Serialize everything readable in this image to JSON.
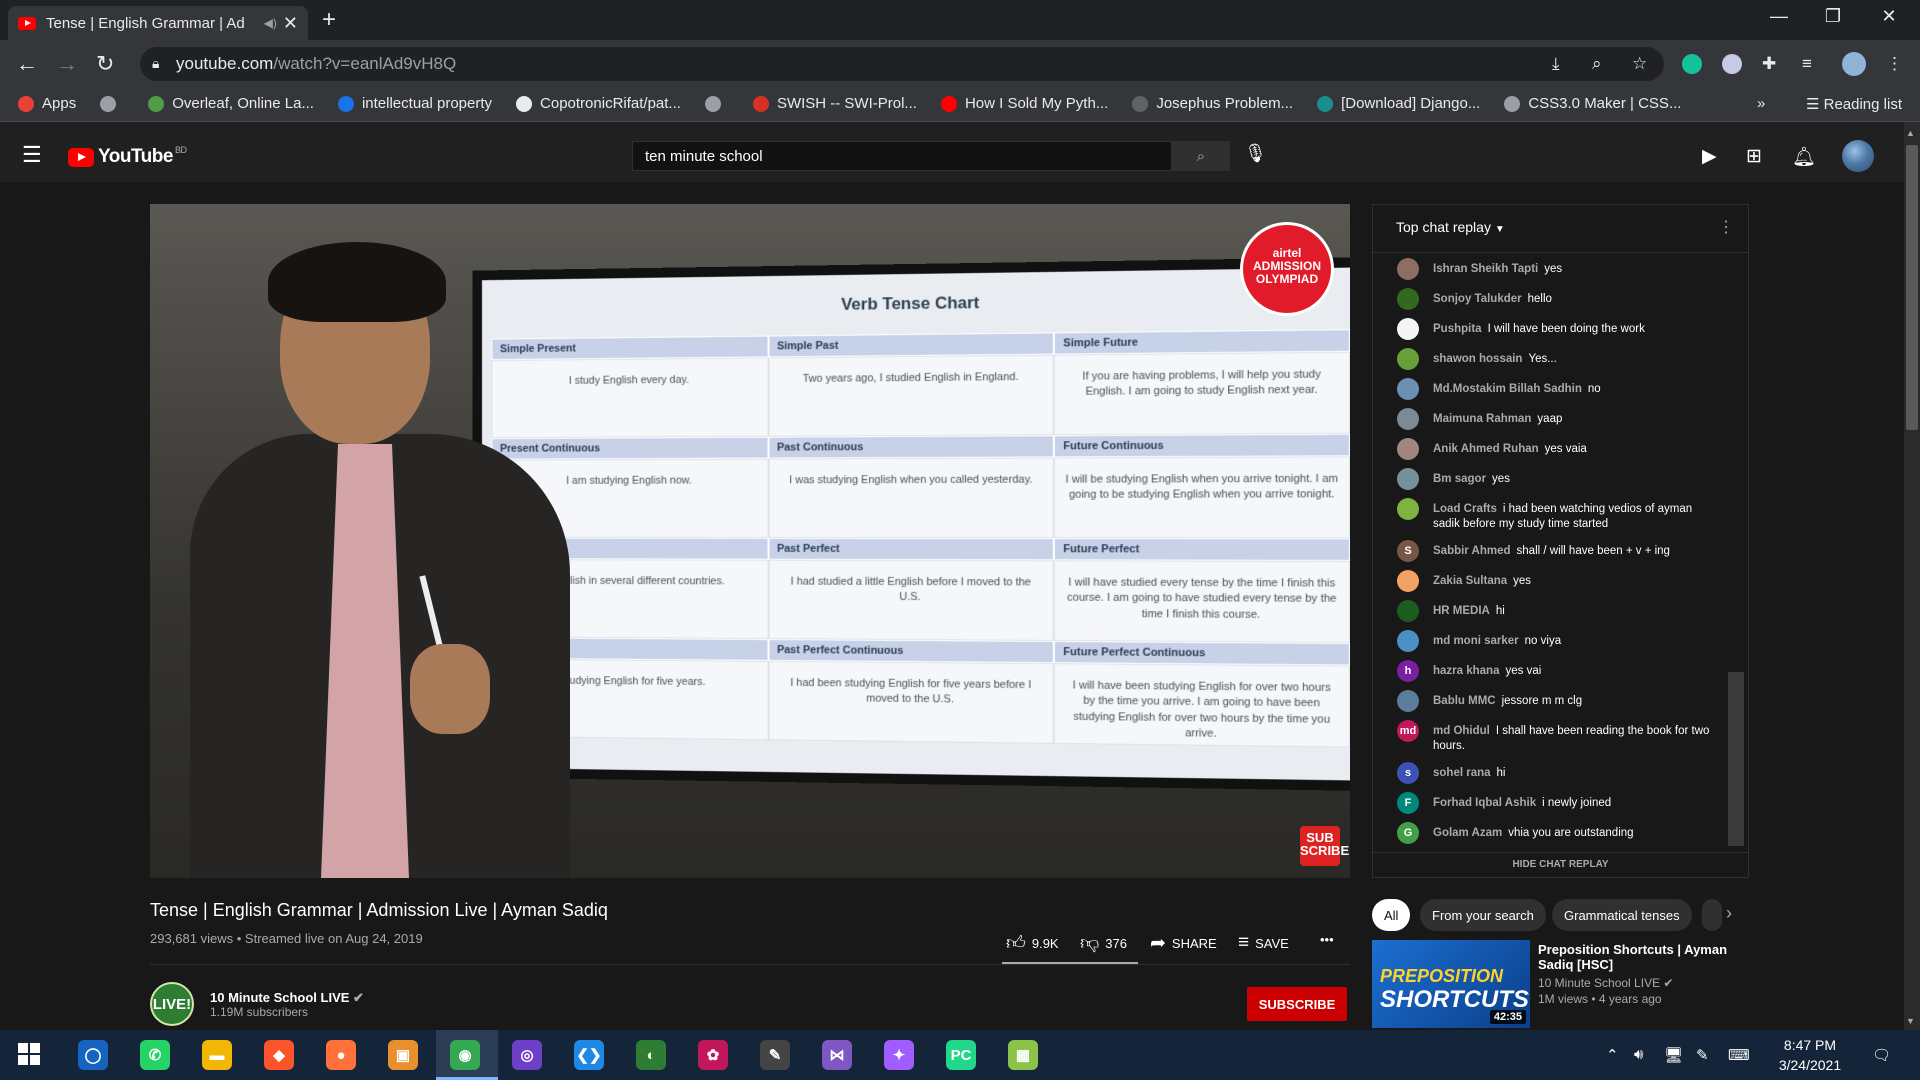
{
  "browser": {
    "tab_title": "Tense | English Grammar | Ad",
    "tab_close": "✕",
    "new_tab": "+",
    "url_host": "youtube.com",
    "url_path": "/watch?v=eanlAd9vH8Q",
    "window_controls": [
      "—",
      "❐",
      "✕"
    ],
    "bookmarks": [
      {
        "label": "Apps",
        "icon": "apps-grid-icon",
        "color": "#ea4335"
      },
      {
        "label": "",
        "icon": "globe-icon",
        "color": "#9aa0a6"
      },
      {
        "label": "Overleaf, Online La...",
        "icon": "overleaf-icon",
        "color": "#4f9c45"
      },
      {
        "label": "intellectual property",
        "icon": "s-icon",
        "color": "#1a73e8"
      },
      {
        "label": "CopotronicRifat/pat...",
        "icon": "github-icon",
        "color": "#e8eaed"
      },
      {
        "label": "",
        "icon": "globe-icon",
        "color": "#9aa0a6"
      },
      {
        "label": "SWISH -- SWI-Prol...",
        "icon": "swish-icon",
        "color": "#d93025"
      },
      {
        "label": "How I Sold My Pyth...",
        "icon": "youtube-icon",
        "color": "#ff0000"
      },
      {
        "label": "Josephus Problem...",
        "icon": "loading-icon",
        "color": "#5f6368"
      },
      {
        "label": "[Download] Django...",
        "icon": "django-icon",
        "color": "#1b8d8a"
      },
      {
        "label": "CSS3.0 Maker | CSS...",
        "icon": "globe-icon",
        "color": "#9aa0a6"
      }
    ],
    "more_bookmarks": "»",
    "reading_list": "Reading list"
  },
  "youtube": {
    "logo_text": "YouTube",
    "country_code": "BD",
    "search_value": "ten minute school"
  },
  "video": {
    "title": "Tense | English Grammar | Admission Live | Ayman Sadiq",
    "views": "293,681 views",
    "streamed": "Streamed live on Aug 24, 2019",
    "likes": "9.9K",
    "dislikes": "376",
    "share": "SHARE",
    "save": "SAVE",
    "more": "•••",
    "overlay_badge": "airtel ADMISSION OLYMPIAD",
    "overlay_sub": "SUB SCRIBE",
    "board": {
      "title": "Verb Tense Chart",
      "headers": [
        [
          "Simple Present",
          "Simple Past",
          "Simple Future"
        ],
        [
          "Present Continuous",
          "Past Continuous",
          "Future Continuous"
        ],
        [
          "",
          "Past Perfect",
          "Future Perfect"
        ],
        [
          "Continuous",
          "Past Perfect Continuous",
          "Future Perfect Continuous"
        ]
      ],
      "rows": [
        [
          "I study English every day.",
          "Two years ago, I studied English in England.",
          "If you are having problems, I will help you study English. I am going to study English next year."
        ],
        [
          "I am studying English now.",
          "I was studying English when you called yesterday.",
          "I will be studying English when you arrive tonight. I am going to be studying English when you arrive tonight."
        ],
        [
          "...d English in several different countries.",
          "I had studied a little English before I moved to the U.S.",
          "I will have studied every tense by the time I finish this course. I am going to have studied every tense by the time I finish this course."
        ],
        [
          "...studying English for five years.",
          "I had been studying English for five years before I moved to the U.S.",
          "I will have been studying English for over two hours by the time you arrive. I am going to have been studying English for over two hours by the time you arrive."
        ]
      ]
    }
  },
  "channel": {
    "name": "10 Minute School LIVE",
    "subscribers": "1.19M subscribers",
    "avatar_text": "LIVE!",
    "subscribe": "SUBSCRIBE"
  },
  "chat": {
    "title": "Top chat replay",
    "hide": "HIDE CHAT REPLAY",
    "messages": [
      {
        "name": "Ishran Sheikh Tapti",
        "text": "yes",
        "initial": "",
        "color": "#8d6e63"
      },
      {
        "name": "Sonjoy Talukder",
        "text": "hello",
        "initial": "",
        "color": "#33691e"
      },
      {
        "name": "Pushpita",
        "text": "I will have been doing the work",
        "initial": "",
        "color": "#f5f5f5"
      },
      {
        "name": "shawon hossain",
        "text": "Yes...",
        "initial": "",
        "color": "#689f38"
      },
      {
        "name": "Md.Mostakim Billah Sadhin",
        "text": "no",
        "initial": "",
        "color": "#6d8fb3"
      },
      {
        "name": "Maimuna Rahman",
        "text": "yaap",
        "initial": "",
        "color": "#7b8a96"
      },
      {
        "name": "Anik Ahmed Ruhan",
        "text": "yes vaia",
        "initial": "",
        "color": "#a1887f"
      },
      {
        "name": "Bm sagor",
        "text": "yes",
        "initial": "",
        "color": "#78909c"
      },
      {
        "name": "Load Crafts",
        "text": "i had been watching vedios of ayman sadik before my study time started",
        "initial": "",
        "color": "#7cb342"
      },
      {
        "name": "Sabbir Ahmed",
        "text": "shall / will have been + v + ing",
        "initial": "S",
        "color": "#795548"
      },
      {
        "name": "Zakia Sultana",
        "text": "yes",
        "initial": "",
        "color": "#f4a261"
      },
      {
        "name": "HR MEDIA",
        "text": "hi",
        "initial": "",
        "color": "#1b5e20"
      },
      {
        "name": "md moni sarker",
        "text": "no viya",
        "initial": "",
        "color": "#4a90c2"
      },
      {
        "name": "hazra khana",
        "text": "yes vai",
        "initial": "h",
        "color": "#7b1fa2"
      },
      {
        "name": "Bablu MMC",
        "text": "jessore m m clg",
        "initial": "",
        "color": "#5c7c9b"
      },
      {
        "name": "md Ohidul",
        "text": "I shall have been reading the book for two hours.",
        "initial": "md",
        "color": "#c2185b"
      },
      {
        "name": "sohel rana",
        "text": "hi",
        "initial": "s",
        "color": "#3f51b5"
      },
      {
        "name": "Forhad Iqbal Ashik",
        "text": "i newly joined",
        "initial": "F",
        "color": "#00897b"
      },
      {
        "name": "Golam Azam",
        "text": "vhia you are outstanding",
        "initial": "G",
        "color": "#43a047"
      }
    ]
  },
  "chips": [
    "All",
    "From your search",
    "Grammatical tenses"
  ],
  "recommendation": {
    "title": "Preposition Shortcuts | Ayman Sadiq [HSC]",
    "channel": "10 Minute School LIVE",
    "meta": "1M views • 4 years ago",
    "duration": "42:35",
    "thumb_line1": "PREPOSITION",
    "thumb_line2": "SHORTCUTS"
  },
  "taskbar": {
    "time": "8:47 PM",
    "date": "3/24/2021",
    "apps": [
      {
        "name": "cortana-icon",
        "label": "◯",
        "color": "#1565c0"
      },
      {
        "name": "whatsapp-icon",
        "label": "✆",
        "color": "#25d366"
      },
      {
        "name": "file-explorer-icon",
        "label": "▬",
        "color": "#f2b705"
      },
      {
        "name": "brave-icon",
        "label": "◆",
        "color": "#fb542b"
      },
      {
        "name": "firefox-icon",
        "label": "●",
        "color": "#ff7139"
      },
      {
        "name": "office-icon",
        "label": "▣",
        "color": "#ea8f2e"
      },
      {
        "name": "chrome-icon",
        "label": "◉",
        "color": "#34a853"
      },
      {
        "name": "github-desktop-icon",
        "label": "◎",
        "color": "#6e40c9"
      },
      {
        "name": "vscode-icon",
        "label": "❮❯",
        "color": "#1e88e5"
      },
      {
        "name": "globe-app-icon",
        "label": "◐",
        "color": "#2e7d32"
      },
      {
        "name": "paint-icon",
        "label": "✿",
        "color": "#c2185b"
      },
      {
        "name": "inkscape-icon",
        "label": "✎",
        "color": "#444444"
      },
      {
        "name": "visual-studio-icon",
        "label": "⋈",
        "color": "#7e57c2"
      },
      {
        "name": "messenger-icon",
        "label": "✦",
        "color": "#a05cff"
      },
      {
        "name": "pycharm-icon",
        "label": "PC",
        "color": "#21d789"
      },
      {
        "name": "spreadsheet-icon",
        "label": "▦",
        "color": "#8bc34a"
      }
    ]
  },
  "colors": {
    "youtube_red": "#ff0000",
    "subscribe_red": "#cc0000",
    "page_bg": "#181818",
    "header_bg": "#202020",
    "chrome_bg": "#35363a"
  }
}
